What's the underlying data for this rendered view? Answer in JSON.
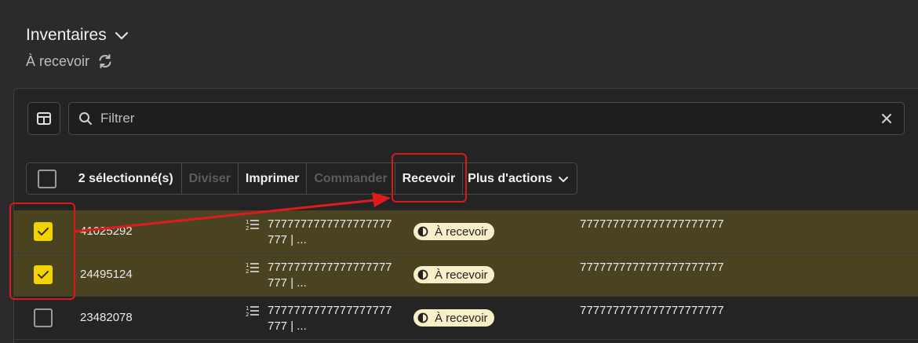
{
  "header": {
    "title": "Inventaires",
    "subtitle": "À recevoir"
  },
  "toolbar": {
    "filter_placeholder": "Filtrer"
  },
  "actions": {
    "selected_count": "2 sélectionné(s)",
    "split": "Diviser",
    "print": "Imprimer",
    "order": "Commander",
    "receive": "Recevoir",
    "more": "Plus d'actions"
  },
  "rows": [
    {
      "id": "41025292",
      "description": "7777777777777777777777 | ...",
      "status": "À recevoir",
      "quantity": "7777777777777777777777",
      "selected": true
    },
    {
      "id": "24495124",
      "description": "7777777777777777777777 | ...",
      "status": "À recevoir",
      "quantity": "7777777777777777777777",
      "selected": true
    },
    {
      "id": "23482078",
      "description": "7777777777777777777777 | ...",
      "status": "À recevoir",
      "quantity": "7777777777777777777777",
      "selected": false
    }
  ],
  "colors": {
    "accent_yellow": "#f2d300",
    "selected_row": "#4a4322",
    "annotation_red": "#d9191c",
    "status_badge": "#f6efc8"
  }
}
